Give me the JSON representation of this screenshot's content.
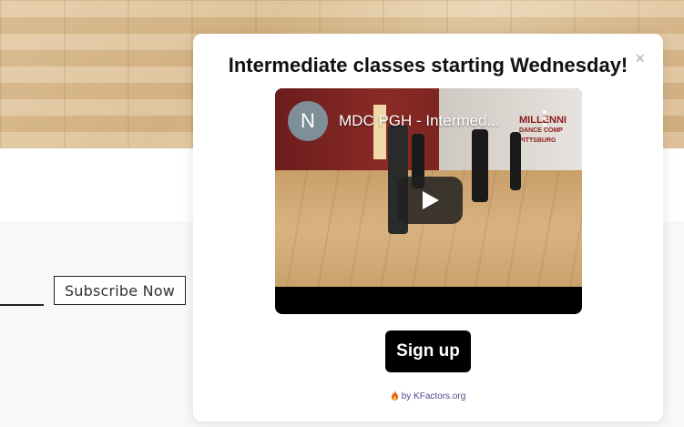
{
  "page": {
    "subscribe_label": "Subscribe Now"
  },
  "popup": {
    "close_glyph": "×",
    "title": "Intermediate classes starting Wednesday!",
    "video": {
      "channel_initial": "N",
      "title": "MDC PGH - Intermed...",
      "sign_line1": "MILLENNI",
      "sign_line2": "DANCE COMP",
      "sign_line3": "PITTSBURG"
    },
    "signup_label": "Sign up",
    "credit": "by KFactors.org"
  },
  "colors": {
    "popup_bg": "#ffffff",
    "button_bg": "#000000",
    "credit_text": "#4a4a8a"
  }
}
